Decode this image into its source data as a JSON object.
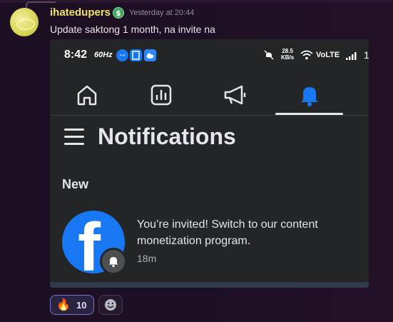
{
  "message": {
    "username": "ihatedupers",
    "role_badge": "$",
    "timestamp": "Yesterday at 20:44",
    "text": "Update saktong 1 month, na invite na"
  },
  "screenshot": {
    "status_bar": {
      "time": "8:42",
      "refresh_rate": "60Hz",
      "net_speed_value": "28.5",
      "net_speed_unit": "KB/s",
      "network": "VoLTE",
      "battery": "1",
      "icons": [
        "messenger-icon",
        "app-icon",
        "cloud-icon",
        "mute-icon",
        "wifi-icon",
        "signal-icon"
      ]
    },
    "tabs": [
      {
        "name": "home",
        "icon": "home-icon",
        "active": false
      },
      {
        "name": "dashboard",
        "icon": "chart-icon",
        "active": false
      },
      {
        "name": "promote",
        "icon": "megaphone-icon",
        "active": false
      },
      {
        "name": "notifications",
        "icon": "bell-icon",
        "active": true
      }
    ],
    "page_title": "Notifications",
    "section_new": "New",
    "notification": {
      "text": "You’re invited! Switch to our content monetization program.",
      "time": "18m",
      "logo_letter": "f"
    }
  },
  "reactions": [
    {
      "emoji": "🔥",
      "count": "10"
    }
  ],
  "colors": {
    "username": "#f0e36a",
    "facebook_blue": "#1877f2",
    "active_tab": "#1877f2",
    "reaction_border": "#6e74d8"
  }
}
